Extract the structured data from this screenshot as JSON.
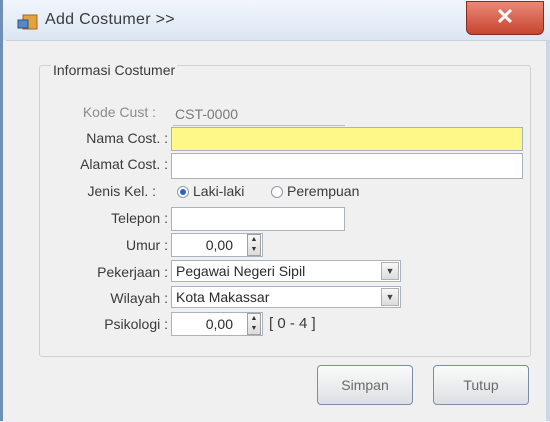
{
  "window": {
    "title": "Add Costumer >>",
    "close_label": "✕"
  },
  "group": {
    "title": "Informasi Costumer"
  },
  "form": {
    "kode_label": "Kode Cust :",
    "kode_value": "CST-0000",
    "nama_label": "Nama Cost. :",
    "nama_value": "",
    "alamat_label": "Alamat Cost. :",
    "alamat_value": "",
    "jenis_label": "Jenis Kel. :",
    "gender_options": [
      "Laki-laki",
      "Perempuan"
    ],
    "gender_selected": "Laki-laki",
    "telepon_label": "Telepon :",
    "telepon_value": "",
    "umur_label": "Umur :",
    "umur_value": "0,00",
    "pekerjaan_label": "Pekerjaan :",
    "pekerjaan_value": "Pegawai Negeri Sipil",
    "wilayah_label": "Wilayah :",
    "wilayah_value": "Kota Makassar",
    "psikologi_label": "Psikologi :",
    "psikologi_value": "0,00",
    "psikologi_range": "[ 0 - 4 ]"
  },
  "buttons": {
    "simpan": "Simpan",
    "tutup": "Tutup"
  },
  "colors": {
    "highlight_field": "#fdf887",
    "close_button": "#c8442f"
  }
}
